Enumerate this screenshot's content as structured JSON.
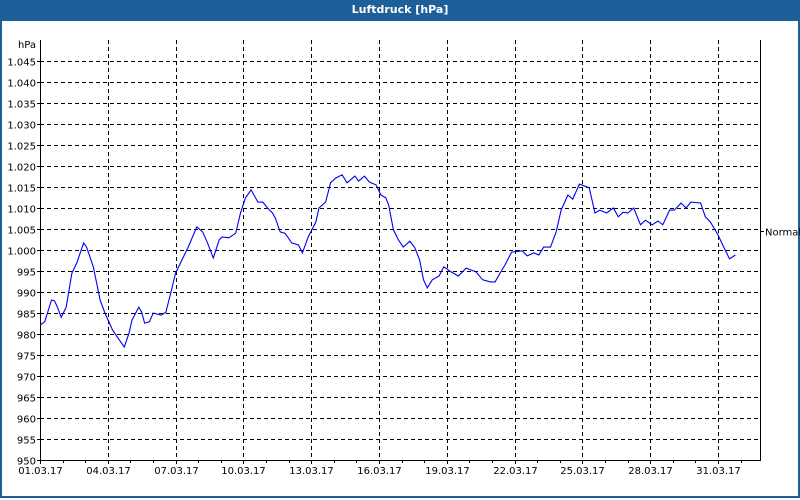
{
  "window": {
    "title": "Luftdruck [hPa]"
  },
  "chart_data": {
    "type": "line",
    "title": "Luftdruck [hPa]",
    "ylabel": "hPa",
    "xlabel": "",
    "ylim": [
      950,
      1050
    ],
    "yticks": [
      950,
      955,
      960,
      965,
      970,
      975,
      980,
      985,
      990,
      995,
      1000,
      1005,
      1010,
      1015,
      1020,
      1025,
      1030,
      1035,
      1040,
      1045
    ],
    "ytick_labels": [
      "950",
      "955",
      "960",
      "965",
      "970",
      "975",
      "980",
      "985",
      "990",
      "995",
      "1.000",
      "1.005",
      "1.010",
      "1.015",
      "1.020",
      "1.025",
      "1.030",
      "1.035",
      "1.040",
      "1.045"
    ],
    "x_unit": "days since 01.03.17",
    "xlim": [
      0,
      31.86
    ],
    "xticks": [
      0,
      3,
      6,
      9,
      12,
      15,
      18,
      21,
      24,
      27,
      30
    ],
    "xtick_labels": [
      "01.03.17",
      "04.03.17",
      "07.03.17",
      "10.03.17",
      "13.03.17",
      "16.03.17",
      "19.03.17",
      "22.03.17",
      "25.03.17",
      "28.03.17",
      "31.03.17"
    ],
    "grid": true,
    "reference": {
      "label": "Normal",
      "value": 1004.5
    },
    "line_color": "#0000ee",
    "series": [
      {
        "name": "Luftdruck",
        "points": [
          [
            0,
            982.1
          ],
          [
            0.21,
            982.9
          ],
          [
            0.51,
            988.1
          ],
          [
            0.64,
            987.9
          ],
          [
            0.77,
            986.4
          ],
          [
            0.94,
            984.0
          ],
          [
            1.16,
            986.4
          ],
          [
            1.41,
            994.5
          ],
          [
            1.63,
            996.9
          ],
          [
            1.93,
            1001.7
          ],
          [
            2.06,
            1000.7
          ],
          [
            2.36,
            996.0
          ],
          [
            2.66,
            988.1
          ],
          [
            2.87,
            985.0
          ],
          [
            3.21,
            981.0
          ],
          [
            3.51,
            978.6
          ],
          [
            3.73,
            976.9
          ],
          [
            3.94,
            980.2
          ],
          [
            4.07,
            983.3
          ],
          [
            4.37,
            986.4
          ],
          [
            4.5,
            985.2
          ],
          [
            4.63,
            982.6
          ],
          [
            4.84,
            982.9
          ],
          [
            5.01,
            985.0
          ],
          [
            5.36,
            984.5
          ],
          [
            5.57,
            985.2
          ],
          [
            5.79,
            989.8
          ],
          [
            6.0,
            994.5
          ],
          [
            6.34,
            998.3
          ],
          [
            6.56,
            1000.7
          ],
          [
            6.94,
            1005.5
          ],
          [
            7.2,
            1004.3
          ],
          [
            7.41,
            1001.7
          ],
          [
            7.67,
            998.1
          ],
          [
            7.93,
            1002.4
          ],
          [
            8.06,
            1003.1
          ],
          [
            8.36,
            1002.9
          ],
          [
            8.66,
            1004.0
          ],
          [
            8.87,
            1008.8
          ],
          [
            9.09,
            1012.4
          ],
          [
            9.34,
            1014.3
          ],
          [
            9.64,
            1011.4
          ],
          [
            9.86,
            1011.4
          ],
          [
            10.07,
            1010.0
          ],
          [
            10.29,
            1008.8
          ],
          [
            10.41,
            1007.6
          ],
          [
            10.63,
            1004.3
          ],
          [
            10.84,
            1004.0
          ],
          [
            11.14,
            1001.7
          ],
          [
            11.44,
            1001.2
          ],
          [
            11.61,
            999.3
          ],
          [
            11.87,
            1003.1
          ],
          [
            12.21,
            1006.7
          ],
          [
            12.34,
            1010.0
          ],
          [
            12.64,
            1011.4
          ],
          [
            12.86,
            1016.0
          ],
          [
            13.07,
            1017.1
          ],
          [
            13.37,
            1017.9
          ],
          [
            13.59,
            1016.0
          ],
          [
            13.93,
            1017.6
          ],
          [
            14.1,
            1016.4
          ],
          [
            14.36,
            1017.6
          ],
          [
            14.57,
            1016.2
          ],
          [
            14.87,
            1015.5
          ],
          [
            15.09,
            1013.1
          ],
          [
            15.3,
            1012.4
          ],
          [
            15.43,
            1010.7
          ],
          [
            15.64,
            1004.8
          ],
          [
            15.86,
            1002.4
          ],
          [
            16.07,
            1000.7
          ],
          [
            16.37,
            1002.1
          ],
          [
            16.59,
            1000.5
          ],
          [
            16.8,
            997.6
          ],
          [
            16.97,
            992.9
          ],
          [
            17.14,
            991.0
          ],
          [
            17.36,
            992.9
          ],
          [
            17.66,
            993.8
          ],
          [
            17.87,
            996.0
          ],
          [
            18.13,
            995.0
          ],
          [
            18.51,
            993.8
          ],
          [
            18.86,
            995.7
          ],
          [
            19.29,
            994.8
          ],
          [
            19.59,
            992.9
          ],
          [
            19.93,
            992.4
          ],
          [
            20.14,
            992.4
          ],
          [
            20.36,
            994.5
          ],
          [
            20.57,
            996.4
          ],
          [
            20.87,
            999.5
          ],
          [
            21.34,
            999.8
          ],
          [
            21.56,
            998.6
          ],
          [
            21.86,
            999.3
          ],
          [
            22.07,
            998.8
          ],
          [
            22.29,
            1000.7
          ],
          [
            22.59,
            1000.7
          ],
          [
            22.84,
            1004.3
          ],
          [
            23.06,
            1009.5
          ],
          [
            23.36,
            1013.1
          ],
          [
            23.57,
            1012.1
          ],
          [
            23.87,
            1015.7
          ],
          [
            24.3,
            1014.8
          ],
          [
            24.56,
            1008.8
          ],
          [
            24.77,
            1009.5
          ],
          [
            25.07,
            1008.8
          ],
          [
            25.37,
            1010.0
          ],
          [
            25.59,
            1007.9
          ],
          [
            25.8,
            1009.0
          ],
          [
            26.01,
            1008.8
          ],
          [
            26.27,
            1010.0
          ],
          [
            26.57,
            1006.0
          ],
          [
            26.79,
            1007.1
          ],
          [
            27.09,
            1006.0
          ],
          [
            27.34,
            1006.9
          ],
          [
            27.56,
            1006.0
          ],
          [
            27.86,
            1009.5
          ],
          [
            28.07,
            1009.5
          ],
          [
            28.37,
            1011.2
          ],
          [
            28.59,
            1010.0
          ],
          [
            28.8,
            1011.4
          ],
          [
            29.23,
            1011.2
          ],
          [
            29.44,
            1007.9
          ],
          [
            29.66,
            1006.7
          ],
          [
            30.0,
            1003.6
          ],
          [
            30.21,
            1001.2
          ],
          [
            30.51,
            997.9
          ],
          [
            30.77,
            998.8
          ]
        ]
      }
    ]
  }
}
